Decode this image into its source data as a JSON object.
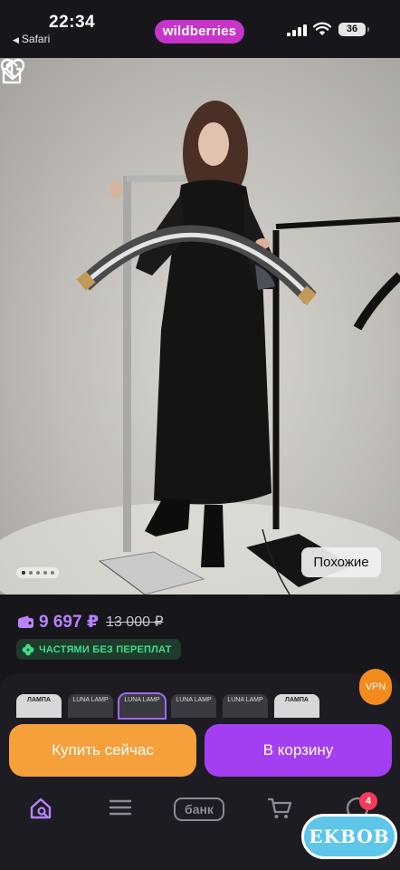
{
  "status": {
    "time": "22:34",
    "back_app": "Safari",
    "battery": "36"
  },
  "header": {
    "brand": "wildberries"
  },
  "photo": {
    "similar_label": "Похожие",
    "carousel_dots": 5,
    "active_dot": 0
  },
  "product": {
    "price": "9 697 ₽",
    "old_price": "13 000 ₽",
    "installment_label": "ЧАСТЯМИ БЕЗ ПЕРЕПЛАТ"
  },
  "variants": [
    {
      "label": "ЛАМПА",
      "style": "light"
    },
    {
      "label": "LUNA LAMP",
      "style": "dark"
    },
    {
      "label": "LUNA LAMP",
      "style": "dark",
      "selected": true
    },
    {
      "label": "LUNA LAMP",
      "style": "dark"
    },
    {
      "label": "LUNA LAMP",
      "style": "dark"
    },
    {
      "label": "ЛАМПА",
      "style": "light"
    }
  ],
  "vpn_label": "VPN",
  "actions": {
    "buy_now": "Купить сейчас",
    "add_to_cart": "В корзину"
  },
  "tabbar": {
    "bank_label": "банк",
    "cart_badge": "4"
  },
  "watermark": "EKBOB",
  "colors": {
    "brand": "#c734c9",
    "price": "#b882ff",
    "buy_now": "#f5a03a",
    "add_to_cart": "#a33ff0",
    "installment": "#3fdd8c"
  }
}
